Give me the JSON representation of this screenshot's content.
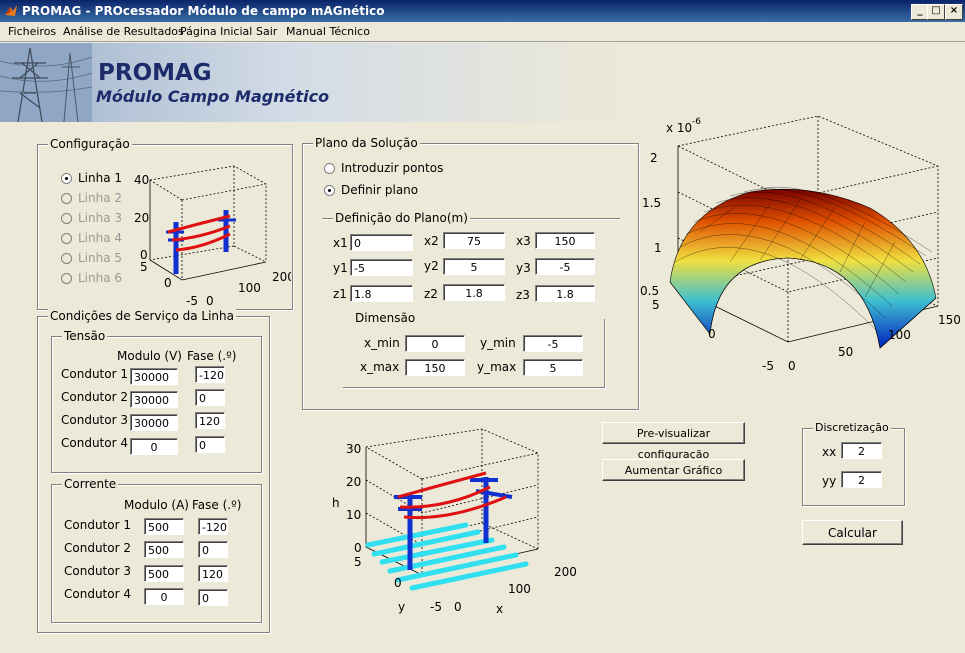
{
  "window": {
    "title": "PROMAG - PROcessador Módulo de campo mAGnético",
    "min": "_",
    "max": "□",
    "close": "×"
  },
  "menu": [
    "Ficheiros",
    "Análise de Resultados",
    "Página Inicial",
    "Sair",
    "Manual Técnico"
  ],
  "banner": {
    "title": "PROMAG",
    "subtitle": "Módulo Campo Magnético"
  },
  "configuracao": {
    "title": "Configuração",
    "lines": [
      {
        "label": "Linha 1",
        "selected": true,
        "enabled": true
      },
      {
        "label": "Linha 2",
        "selected": false,
        "enabled": false
      },
      {
        "label": "Linha 3",
        "selected": false,
        "enabled": false
      },
      {
        "label": "Linha 4",
        "selected": false,
        "enabled": false
      },
      {
        "label": "Linha 5",
        "selected": false,
        "enabled": false
      },
      {
        "label": "Linha 6",
        "selected": false,
        "enabled": false
      }
    ],
    "plot_ticks": {
      "z": [
        "40",
        "20",
        "0"
      ],
      "y": [
        "5",
        "0",
        "-5"
      ],
      "x": [
        "0",
        "100",
        "200"
      ]
    }
  },
  "condicoes": {
    "title": "Condições de Serviço da Linha",
    "tensao": {
      "title": "Tensão",
      "col_modulo": "Modulo (V)",
      "col_fase": "Fase (.º)",
      "rows": [
        {
          "label": "Condutor 1",
          "modulo": "30000",
          "fase": "-120"
        },
        {
          "label": "Condutor 2",
          "modulo": "30000",
          "fase": "0"
        },
        {
          "label": "Condutor 3",
          "modulo": "30000",
          "fase": "120"
        },
        {
          "label": "Condutor 4",
          "modulo": "0",
          "fase": "0"
        }
      ]
    },
    "corrente": {
      "title": "Corrente",
      "col_modulo": "Modulo (A)",
      "col_fase": "Fase (.º)",
      "rows": [
        {
          "label": "Condutor 1",
          "modulo": "500",
          "fase": "-120"
        },
        {
          "label": "Condutor 2",
          "modulo": "500",
          "fase": "0"
        },
        {
          "label": "Condutor 3",
          "modulo": "500",
          "fase": "120"
        },
        {
          "label": "Condutor 4",
          "modulo": "0",
          "fase": "0"
        }
      ]
    }
  },
  "plano": {
    "title": "Plano da Solução",
    "opt_pontos": "Introduzir pontos",
    "opt_plano": "Definir plano",
    "selected": "plano",
    "definicao": {
      "title": "Definição do Plano(m)",
      "x1_label": "x1",
      "x1": "0",
      "x2_label": "x2",
      "x2": "75",
      "x3_label": "x3",
      "x3": "150",
      "y1_label": "y1",
      "y1": "-5",
      "y2_label": "y2",
      "y2": "5",
      "y3_label": "y3",
      "y3": "-5",
      "z1_label": "z1",
      "z1": "1.8",
      "z2_label": "z2",
      "z2": "1.8",
      "z3_label": "z3",
      "z3": "1.8"
    },
    "dimensao": {
      "title": "Dimensão",
      "x_min_label": "x_min",
      "x_min": "0",
      "x_max_label": "x_max",
      "x_max": "150",
      "y_min_label": "y_min",
      "y_min": "-5",
      "y_max_label": "y_max",
      "y_max": "5"
    }
  },
  "buttons": {
    "preview": "Pre-visualizar configuração",
    "aumentar": "Aumentar Gráfico",
    "calcular": "Calcular"
  },
  "discretizacao": {
    "title": "Discretização",
    "xx_label": "xx",
    "xx": "2",
    "yy_label": "yy",
    "yy": "2"
  },
  "surface_plot": {
    "exponent": "x 10",
    "exponent_power": "-6",
    "z_ticks": [
      "2",
      "1.5",
      "1",
      "0.5"
    ],
    "y_ticks": [
      "5",
      "0",
      "-5"
    ],
    "x_ticks": [
      "0",
      "50",
      "100",
      "150"
    ]
  },
  "preview_plot": {
    "z_label": "h",
    "y_label": "y",
    "x_label": "x",
    "z_ticks": [
      "30",
      "20",
      "10",
      "0"
    ],
    "y_ticks": [
      "5",
      "0",
      "-5"
    ],
    "x_ticks": [
      "0",
      "100",
      "200"
    ]
  },
  "colors": {
    "conductor": "#e01010",
    "tower": "#1030d0",
    "ground": "#30e0f0",
    "title_blue": "#1c2c6b"
  }
}
